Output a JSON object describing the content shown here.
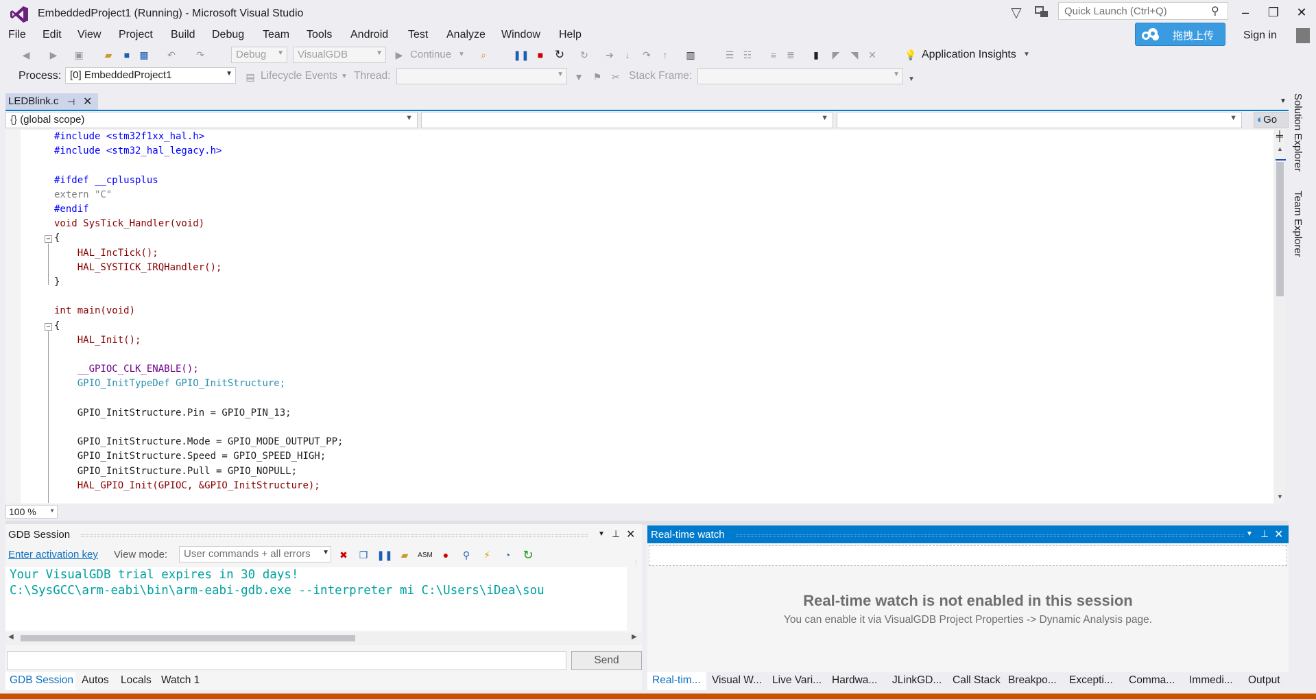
{
  "window": {
    "title": "EmbeddedProject1 (Running) - Microsoft Visual Studio",
    "quick_launch_placeholder": "Quick Launch (Ctrl+Q)",
    "minimize": "–",
    "restore": "❐",
    "close": "✕",
    "baidu_label": "拖拽上传",
    "sign_in": "Sign in"
  },
  "menu": [
    "File",
    "Edit",
    "View",
    "Project",
    "Build",
    "Debug",
    "Team",
    "Tools",
    "Android",
    "Test",
    "Analyze",
    "Window",
    "Help"
  ],
  "toolbar": {
    "config": "Debug",
    "platform": "VisualGDB",
    "continue": "Continue",
    "app_insights": "Application Insights"
  },
  "debug_location": {
    "process_label": "Process:",
    "process_value": "[0] EmbeddedProject1",
    "lifecycle": "Lifecycle Events",
    "thread_label": "Thread:",
    "stack_frame_label": "Stack Frame:"
  },
  "doc_tab": {
    "label": "LEDBlink.c"
  },
  "navbar": {
    "scope": "(global scope)",
    "go": "Go"
  },
  "editor": {
    "zoom": "100 %"
  },
  "side_tabs": [
    "Solution Explorer",
    "Team Explorer"
  ],
  "gdb": {
    "title": "GDB Session",
    "activation_link": "Enter activation key",
    "view_mode_label": "View mode:",
    "view_mode_value": "User commands + all errors",
    "output_line1": "Your VisualGDB trial expires in 30 days!",
    "output_line2": "C:\\SysGCC\\arm-eabi\\bin\\arm-eabi-gdb.exe --interpreter mi C:\\Users\\iDea\\sou",
    "send": "Send"
  },
  "rtw": {
    "title": "Real-time watch",
    "heading": "Real-time watch is not enabled in this session",
    "sub": "You can enable it via VisualGDB Project Properties -> Dynamic Analysis page."
  },
  "bottom_tabs_left": [
    "GDB Session",
    "Autos",
    "Locals",
    "Watch 1"
  ],
  "bottom_tabs_right": [
    "Real-tim...",
    "Visual W...",
    "Live Vari...",
    "Hardwa...",
    "JLinkGD...",
    "Call Stack",
    "Breakpo...",
    "Excepti...",
    "Comma...",
    "Immedi...",
    "Output"
  ],
  "code_tokens": {
    "include1": "#include <stm32f1xx_hal.h>",
    "include2": "#include <stm32_hal_legacy.h>",
    "ifdef": "#ifdef __cplusplus",
    "extern": "extern \"C\"",
    "endif": "#endif",
    "systick_decl": "void SysTick_Handler(void)",
    "inc_tick": "HAL_IncTick();",
    "systick_irq": "HAL_SYSTICK_IRQHandler();",
    "main_decl": "int main(void)",
    "hal_init": "HAL_Init();",
    "clk_enable": "__GPIOC_CLK_ENABLE();",
    "typedef_line": "GPIO_InitTypeDef GPIO_InitStructure;",
    "pin_line": "GPIO_InitStructure.Pin = GPIO_PIN_13;",
    "mode_line": "GPIO_InitStructure.Mode = GPIO_MODE_OUTPUT_PP;",
    "speed_line": "GPIO_InitStructure.Speed = GPIO_SPEED_HIGH;",
    "pull_line": "GPIO_InitStructure.Pull = GPIO_NOPULL;",
    "gpio_init_line": "HAL_GPIO_Init(GPIOC, &GPIO_InitStructure);"
  }
}
